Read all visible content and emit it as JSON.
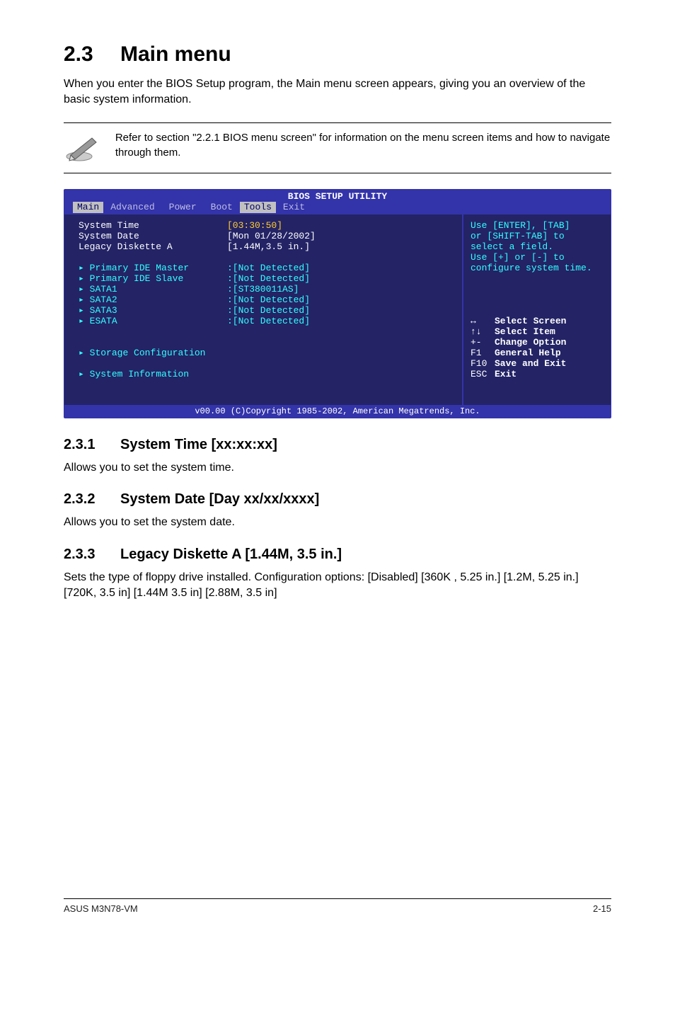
{
  "section": {
    "number": "2.3",
    "title": "Main menu",
    "intro": "When you enter the BIOS Setup program, the Main menu screen appears, giving you an overview of the basic system information."
  },
  "note": "Refer to section \"2.2.1 BIOS menu screen\" for information on the menu screen items and how to navigate through them.",
  "bios": {
    "title": "BIOS SETUP UTILITY",
    "tabs": [
      "Main",
      "Advanced",
      "Power",
      "Boot",
      "Tools",
      "Exit"
    ],
    "highlighted": {
      "time_label": "System Time",
      "time_value": "[03:30:50]",
      "date_label": "System Date",
      "date_value": "[Mon 01/28/2002]",
      "diskette_label": "Legacy Diskette A",
      "diskette_value": "[1.44M,3.5 in.]"
    },
    "items": [
      {
        "label": "Primary IDE Master",
        "value": ":[Not Detected]"
      },
      {
        "label": "Primary IDE Slave",
        "value": ":[Not Detected]"
      },
      {
        "label": "SATA1",
        "value": ":[ST380011AS]"
      },
      {
        "label": "SATA2",
        "value": ":[Not Detected]"
      },
      {
        "label": "SATA3",
        "value": ":[Not Detected]"
      },
      {
        "label": "ESATA",
        "value": ":[Not Detected]"
      }
    ],
    "groups": [
      "Storage Configuration",
      "System Information"
    ],
    "help_top": [
      "Use [ENTER], [TAB]",
      "or [SHIFT-TAB] to",
      "select a field.",
      "",
      "Use [+] or [-] to",
      "configure system time."
    ],
    "help_keys": [
      {
        "k": "↔",
        "d": "Select Screen"
      },
      {
        "k": "↑↓",
        "d": "Select Item"
      },
      {
        "k": "+-",
        "d": "Change Option"
      },
      {
        "k": "F1",
        "d": "General Help"
      },
      {
        "k": "F10",
        "d": "Save and Exit"
      },
      {
        "k": "ESC",
        "d": "Exit"
      }
    ],
    "footer": "v00.00 (C)Copyright 1985-2002, American Megatrends, Inc."
  },
  "subsections": {
    "s231_num": "2.3.1",
    "s231_title": "System Time [xx:xx:xx]",
    "s231_body": "Allows you to set the system time.",
    "s232_num": "2.3.2",
    "s232_title": "System Date [Day xx/xx/xxxx]",
    "s232_body": "Allows you to set the system date.",
    "s233_num": "2.3.3",
    "s233_title": "Legacy Diskette A [1.44M, 3.5 in.]",
    "s233_body": "Sets the type of floppy drive installed. Configuration options: [Disabled] [360K , 5.25 in.] [1.2M, 5.25 in.] [720K, 3.5 in] [1.44M 3.5 in] [2.88M, 3.5 in]"
  },
  "footer": {
    "left": "ASUS M3N78-VM",
    "right": "2-15"
  }
}
